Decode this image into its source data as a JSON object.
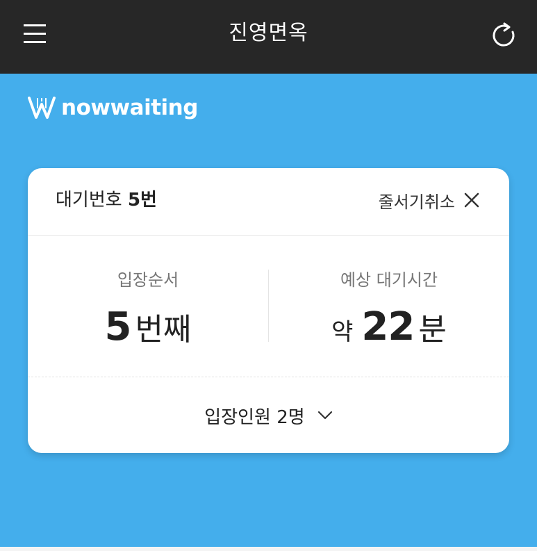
{
  "header": {
    "title": "진영면옥",
    "menu_icon": "hamburger-menu-icon",
    "refresh_icon": "refresh-icon",
    "background": "#272727"
  },
  "brand": {
    "logo_text": "nowwaiting",
    "logo_icon": "nowwaiting-logo-icon",
    "background": "#44aeec"
  },
  "card": {
    "wait_number_label": "대기번호",
    "wait_number_value": "5번",
    "cancel_label": "줄서기취소",
    "cancel_icon": "close-icon",
    "order": {
      "label": "입장순서",
      "value": "5",
      "unit": "번째"
    },
    "estimated": {
      "label": "예상 대기시간",
      "prefix": "약",
      "value": "22",
      "unit": "분"
    },
    "party": {
      "label": "입장인원 2명",
      "icon": "chevron-down-icon"
    }
  }
}
